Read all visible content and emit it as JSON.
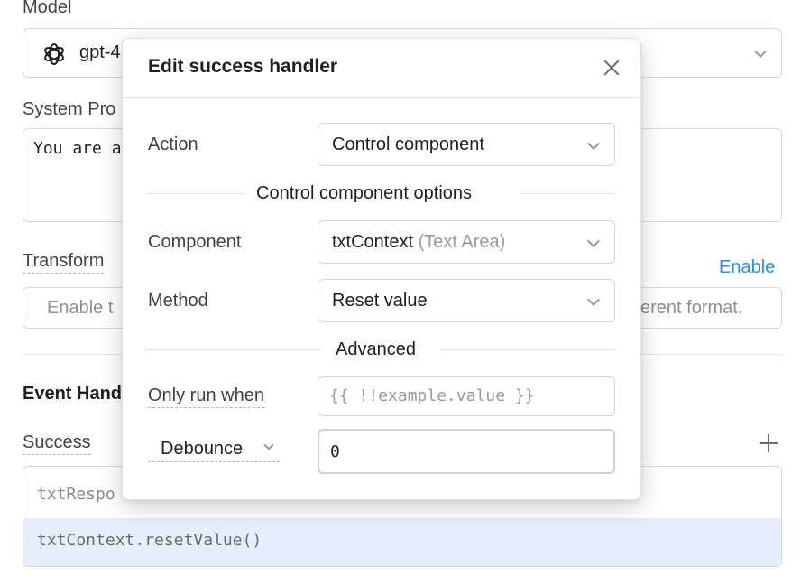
{
  "background": {
    "model_label": "Model",
    "model_value": "gpt-4",
    "system_prompt_label": "System Pro",
    "system_prompt_value": "You are a",
    "transform_label": "Transform",
    "enable_link": "Enable",
    "transform_placeholder_start": "Enable t",
    "transform_placeholder_end": "erent format.",
    "event_handlers_label": "Event Hand",
    "success_label": "Success",
    "handler_rows": [
      "txtRespo",
      "txtContext.resetValue()"
    ]
  },
  "modal": {
    "title": "Edit success handler",
    "action_label": "Action",
    "action_value": "Control component",
    "options_heading": "Control component options",
    "component_label": "Component",
    "component_value": "txtContext",
    "component_type": "(Text Area)",
    "method_label": "Method",
    "method_value": "Reset value",
    "advanced_heading": "Advanced",
    "only_run_when_label": "Only run when",
    "only_run_when_placeholder": "{{ !!example.value }}",
    "debounce_label": "Debounce",
    "debounce_value": "0"
  },
  "colors": {
    "accent": "#2d8fe0",
    "selected_row": "#e4effb"
  },
  "icons": [
    "openai-logo-icon",
    "chevron-down-icon",
    "close-icon",
    "plus-icon"
  ]
}
